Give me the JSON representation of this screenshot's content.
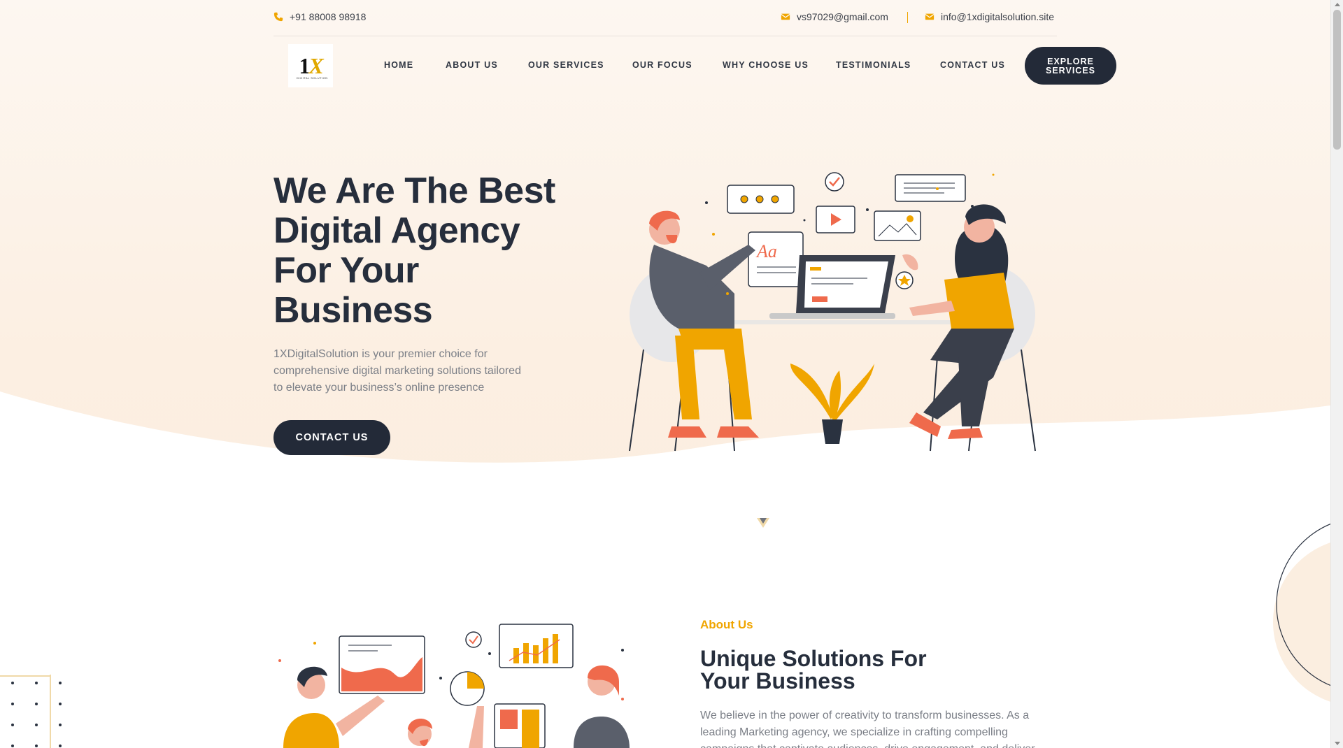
{
  "topbar": {
    "phone": "+91 88008 98918",
    "email1": "vs97029@gmail.com",
    "email2": "info@1xdigitalsolution.site"
  },
  "logo": {
    "main": "1",
    "accent": "X",
    "sub": "DIGITAL SOLUTION"
  },
  "nav": {
    "items": [
      "HOME",
      "ABOUT US",
      "OUR SERVICES",
      "OUR FOCUS",
      "WHY CHOOSE US",
      "TESTIMONIALS",
      "CONTACT US"
    ],
    "cta_line1": "EXPLORE",
    "cta_line2": "SERVICES"
  },
  "hero": {
    "title_lines": [
      "We Are The Best",
      "Digital Agency",
      "For Your",
      "Business"
    ],
    "description": "1XDigitalSolution is your premier choice for comprehensive digital marketing solutions tailored to elevate your business’s online presence",
    "button": "CONTACT US"
  },
  "about": {
    "kicker": "About Us",
    "title_lines": [
      "Unique Solutions For",
      "Your Business"
    ],
    "description": "We believe in the power of creativity to transform businesses. As a leading Marketing agency, we specialize in crafting compelling campaigns that captivate audiences, drive engagement, and deliver"
  },
  "colors": {
    "accent": "#f0a500",
    "dark": "#232a38",
    "coral": "#ef6a4c",
    "hero_bg": "#fcefe2"
  },
  "icons": [
    "phone-icon",
    "mail-icon",
    "mail-icon",
    "chevron-down-icon"
  ]
}
